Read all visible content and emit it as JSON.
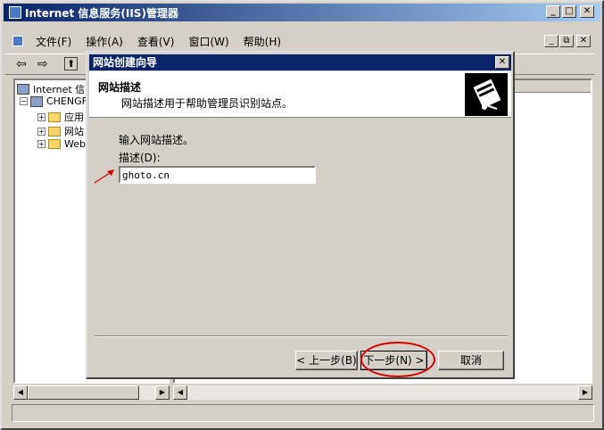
{
  "window": {
    "title": "Internet 信息服务(IIS)管理器",
    "minimize": "_",
    "maximize": "□",
    "close": "✕"
  },
  "menu": {
    "items": [
      "文件(F)",
      "操作(A)",
      "查看(V)",
      "窗口(W)",
      "帮助(H)"
    ]
  },
  "mdi_buttons": [
    "_",
    "⧉",
    "✕"
  ],
  "toolbar": {
    "back": "⇦",
    "forward": "⇨",
    "up": "⬆"
  },
  "tree": {
    "root": "Internet 信",
    "server": "CHENGFA",
    "nodes": [
      "应用",
      "网站",
      "Web"
    ]
  },
  "dialog": {
    "title": "网站创建向导",
    "close": "✕",
    "header_title": "网站描述",
    "header_subtitle": "网站描述用于帮助管理员识别站点。",
    "instruction": "输入网站描述。",
    "desc_label": "描述(D):",
    "desc_value": "ghoto.cn",
    "back_button": "< 上一步(B)",
    "next_button": "下一步(N) >",
    "cancel_button": "取消"
  },
  "colors": {
    "titlebar": "#0a246a",
    "face": "#d4d0c8",
    "highlight": "#d40000"
  }
}
